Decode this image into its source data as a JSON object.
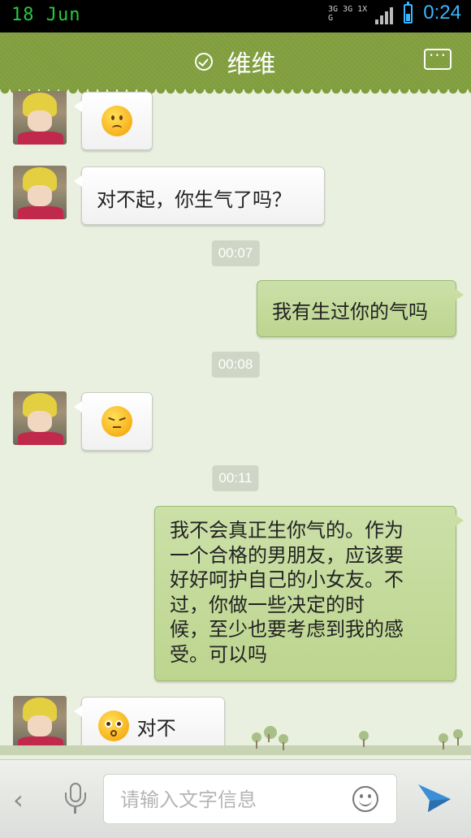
{
  "status_bar": {
    "date": "18 Jun",
    "network": "3G 3G 1X G",
    "time": "0:24",
    "accent_color": "#38b6ff"
  },
  "header": {
    "title": "维维",
    "status_icon": "check-circle-icon",
    "menu_icon": "more-menu-icon",
    "background_color": "#7f9d3c"
  },
  "messages": [
    {
      "side": "in",
      "type": "emoji",
      "emoji": "sad-face-icon"
    },
    {
      "side": "in",
      "type": "text",
      "text": "对不起，你生气了吗？"
    },
    {
      "type": "time",
      "text": "00:07"
    },
    {
      "side": "out",
      "type": "text",
      "text": "我有生过你的气吗"
    },
    {
      "type": "time",
      "text": "00:08"
    },
    {
      "side": "in",
      "type": "emoji",
      "emoji": "squint-face-icon"
    },
    {
      "type": "time",
      "text": "00:11"
    },
    {
      "side": "out",
      "type": "text",
      "lines": [
        "我不会真正生你气的。作为",
        "一个合格的男朋友，应该要",
        "好好呵护自己的小女友。不",
        "过，你做一些决定的时",
        "候，至少也要考虑到我的感",
        "受。可以吗"
      ]
    },
    {
      "side": "in",
      "type": "emoji_text",
      "emoji": "blushing-face-icon",
      "text": "对不起..."
    }
  ],
  "input_bar": {
    "placeholder": "请输入文字信息",
    "value": "",
    "send_color": "#3b8fd6"
  }
}
